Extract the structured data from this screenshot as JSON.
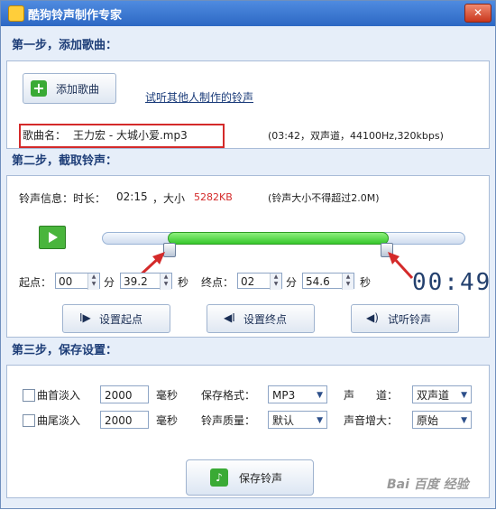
{
  "window": {
    "title": "酷狗铃声制作专家",
    "close_glyph": "✕"
  },
  "step1": {
    "header": "第一步，添加歌曲：",
    "add_song_label": "添加歌曲",
    "add_song_glyph": "+",
    "listen_link": "试听其他人制作的铃声",
    "song_prefix": "歌曲名：",
    "song_name": "王力宏 - 大城小爱.mp3",
    "song_info": "(03:42，双声道，44100Hz,320kbps)"
  },
  "step2": {
    "header": "第二步，截取铃声：",
    "info_prefix": "铃声信息：时长：",
    "duration": "02:15",
    "size_label": "，大小",
    "size_value": "5282KB",
    "limit_note": "(铃声大小不得超过2.0M)",
    "selection": {
      "start_fraction": 0.18,
      "end_fraction": 0.785
    },
    "start_label": "起点：",
    "start_min": "00",
    "min_unit": "分",
    "start_sec": "39.2",
    "sec_unit": "秒",
    "end_label": "终点：",
    "end_min": "02",
    "end_sec": "54.6",
    "timer": "00:49",
    "set_start_label": "设置起点",
    "set_end_label": "设置终点",
    "preview_label": "试听铃声",
    "set_start_glyph": "I▶",
    "set_end_glyph": "◀I",
    "preview_glyph": "◀)"
  },
  "step3": {
    "header": "第三步，保存设置：",
    "fade_in_label": "曲首淡入",
    "fade_in_value": "2000",
    "fade_out_label": "曲尾淡入",
    "fade_out_value": "2000",
    "ms_unit": "毫秒",
    "format_label": "保存格式：",
    "format_value": "MP3",
    "quality_label": "铃声质量：",
    "quality_value": "默认",
    "channel_label": "声　　道：",
    "channel_value": "双声道",
    "volume_label": "声音增大：",
    "volume_value": "原始",
    "save_label": "保存铃声",
    "save_glyph": "♪"
  },
  "watermark": "Bai 百度 经验",
  "colors": {
    "accent": "#2d68c4",
    "progress": "#36c72a",
    "highlight": "#d42a2a"
  }
}
